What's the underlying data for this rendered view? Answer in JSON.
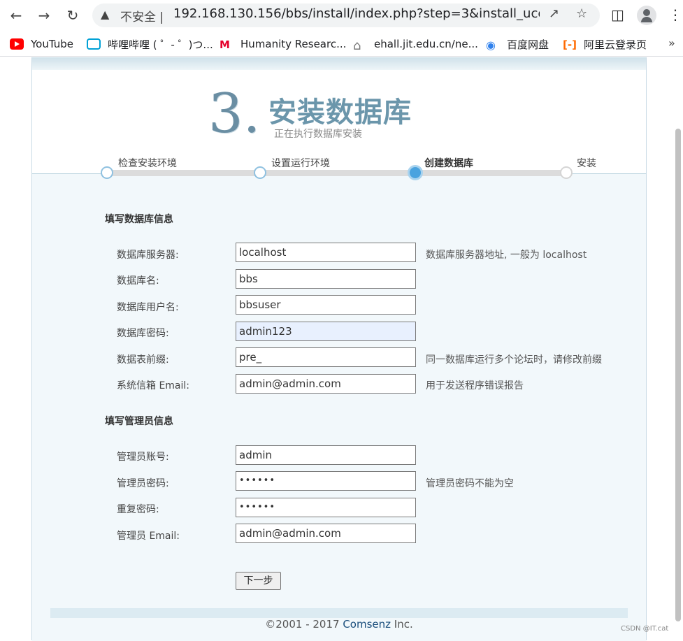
{
  "browser": {
    "warning_icon": "warning-triangle-icon",
    "insecure_label": "不安全 |",
    "url": "192.168.130.156/bbs/install/index.php?step=3&install_ucenter=...",
    "bookmarks": [
      {
        "label": "YouTube",
        "icon": "youtube-icon"
      },
      {
        "label": "哔哩哔哩 ( ゜- ゜)つ...",
        "icon": "bilibili-icon"
      },
      {
        "label": "Humanity Researc...",
        "icon": "humanity-icon"
      },
      {
        "label": "ehall.jit.edu.cn/ne...",
        "icon": "house-icon"
      },
      {
        "label": "百度网盘",
        "icon": "baidu-netdisk-icon"
      },
      {
        "label": "阿里云登录页",
        "icon": "aliyun-icon"
      }
    ],
    "more_bookmarks": "»"
  },
  "installer": {
    "step_number": "3.",
    "step_title": "安装数据库",
    "step_subtitle": "正在执行数据库安装",
    "steps": [
      {
        "label": "检查安装环境",
        "state": "done"
      },
      {
        "label": "设置运行环境",
        "state": "done"
      },
      {
        "label": "创建数据库",
        "state": "current"
      },
      {
        "label": "安装",
        "state": "pending"
      }
    ],
    "db_section_title": "填写数据库信息",
    "db_fields": {
      "server": {
        "label": "数据库服务器:",
        "value": "localhost",
        "hint": "数据库服务器地址, 一般为 localhost"
      },
      "name": {
        "label": "数据库名:",
        "value": "bbs"
      },
      "user": {
        "label": "数据库用户名:",
        "value": "bbsuser"
      },
      "password": {
        "label": "数据库密码:",
        "value": "admin123"
      },
      "prefix": {
        "label": "数据表前缀:",
        "value": "pre_",
        "hint": "同一数据库运行多个论坛时，请修改前缀"
      },
      "email": {
        "label": "系统信箱 Email:",
        "value": "admin@admin.com",
        "hint": "用于发送程序错误报告"
      }
    },
    "admin_section_title": "填写管理员信息",
    "admin_fields": {
      "account": {
        "label": "管理员账号:",
        "value": "admin"
      },
      "password": {
        "label": "管理员密码:",
        "value": "••••••",
        "hint": "管理员密码不能为空"
      },
      "repeat": {
        "label": "重复密码:",
        "value": "••••••"
      },
      "email": {
        "label": "管理员 Email:",
        "value": "admin@admin.com"
      }
    },
    "next_button": "下一步",
    "footer_prefix": "©2001 - 2017 ",
    "footer_brand": "Comsenz",
    "footer_suffix": " Inc."
  },
  "watermark": "CSDN @IT.cat"
}
